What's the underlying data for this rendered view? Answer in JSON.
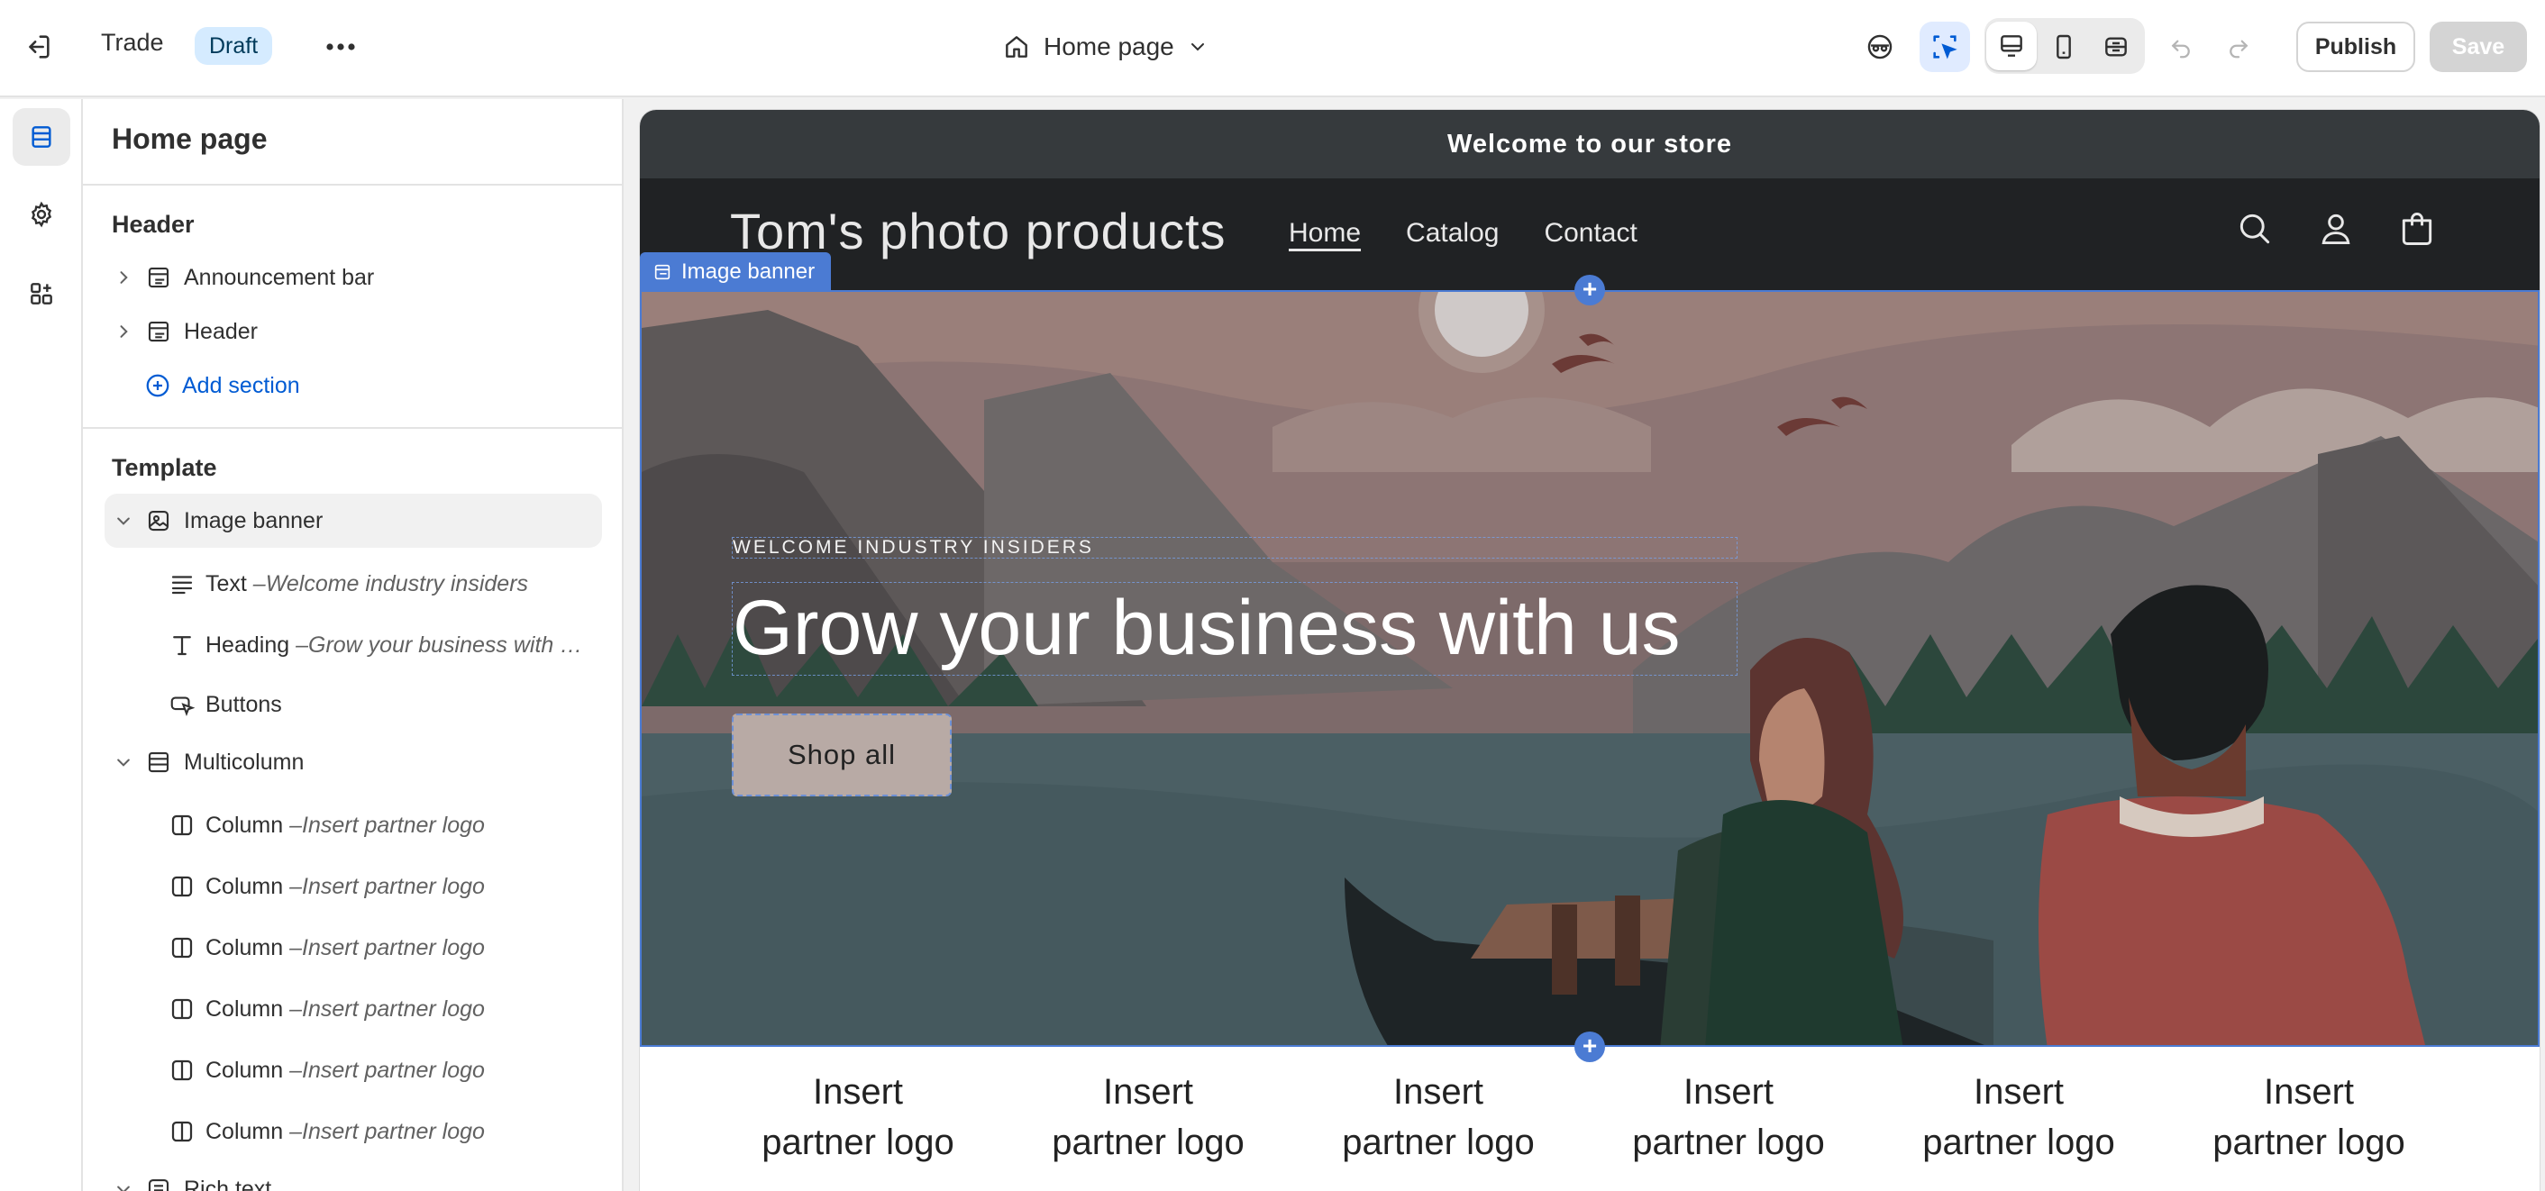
{
  "topbar": {
    "theme_name": "Trade",
    "status_badge": "Draft",
    "page_selector": "Home page",
    "publish_label": "Publish",
    "save_label": "Save"
  },
  "sidebar": {
    "title": "Home page",
    "header_group": {
      "title": "Header",
      "items": [
        {
          "label": "Announcement bar"
        },
        {
          "label": "Header"
        }
      ],
      "add_section": "Add section"
    },
    "template_group": {
      "title": "Template",
      "sections": [
        {
          "label": "Image banner",
          "blocks": [
            {
              "label": "Text",
              "sub": "Welcome industry insiders"
            },
            {
              "label": "Heading",
              "sub": "Grow your business with us"
            },
            {
              "label": "Buttons",
              "sub": ""
            }
          ]
        },
        {
          "label": "Multicolumn",
          "blocks": [
            {
              "label": "Column",
              "sub": "Insert partner logo"
            },
            {
              "label": "Column",
              "sub": "Insert partner logo"
            },
            {
              "label": "Column",
              "sub": "Insert partner logo"
            },
            {
              "label": "Column",
              "sub": "Insert partner logo"
            },
            {
              "label": "Column",
              "sub": "Insert partner logo"
            },
            {
              "label": "Column",
              "sub": "Insert partner logo"
            }
          ]
        },
        {
          "label": "Rich text"
        }
      ]
    }
  },
  "preview": {
    "announcement": "Welcome to our store",
    "store_name": "Tom's photo products",
    "nav": [
      "Home",
      "Catalog",
      "Contact"
    ],
    "section_tag": "Image banner",
    "banner": {
      "subheading": "WELCOME INDUSTRY INSIDERS",
      "heading": "Grow your business with us",
      "button": "Shop all"
    },
    "logos": [
      {
        "line1": "Insert",
        "line2": "partner logo"
      },
      {
        "line1": "Insert",
        "line2": "partner logo"
      },
      {
        "line1": "Insert",
        "line2": "partner logo"
      },
      {
        "line1": "Insert",
        "line2": "partner logo"
      },
      {
        "line1": "Insert",
        "line2": "partner logo"
      },
      {
        "line1": "Insert",
        "line2": "partner logo"
      }
    ]
  },
  "colors": {
    "accent_blue": "#005bd3",
    "selection_blue": "#4b7bd3",
    "announcement_bg": "#363a3d",
    "header_bg": "#202224"
  }
}
